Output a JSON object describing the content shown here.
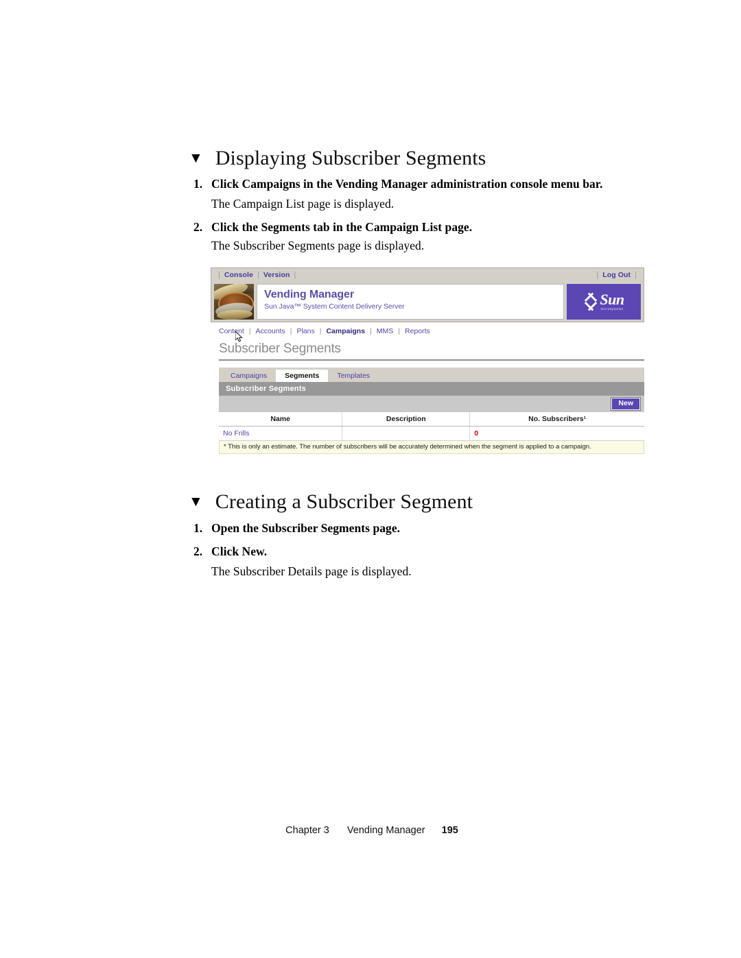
{
  "document": {
    "sections": [
      {
        "heading": "Displaying Subscriber Segments",
        "steps": [
          {
            "num": "1.",
            "text": "Click Campaigns in the Vending Manager administration console menu bar."
          },
          {
            "num": "2.",
            "text": "Click the Segments tab in the Campaign List page."
          }
        ],
        "results": [
          "The Campaign List page is displayed.",
          "The Subscriber Segments page is displayed."
        ]
      },
      {
        "heading": "Creating a Subscriber Segment",
        "steps": [
          {
            "num": "1.",
            "text": "Open the Subscriber Segments page."
          },
          {
            "num": "2.",
            "text": "Click New."
          }
        ],
        "results": [
          "The Subscriber Details page is displayed."
        ]
      }
    ],
    "footer": {
      "chapter": "Chapter 3",
      "title": "Vending Manager",
      "page": "195"
    },
    "marker_glyph": "▼"
  },
  "screenshot": {
    "topbar": {
      "left_links": [
        "Console",
        "Version"
      ],
      "right_links": [
        "Log Out"
      ],
      "separator": "|"
    },
    "branding": {
      "title": "Vending Manager",
      "subtitle": "Sun Java™ System Content Delivery Server",
      "logo_word": "Sun",
      "logo_tagline": "microsystems",
      "logo_bg": "#5b46b4",
      "thumbnail": "coins-photo"
    },
    "nav": {
      "items": [
        {
          "label": "Content",
          "active": false
        },
        {
          "label": "Accounts",
          "active": false
        },
        {
          "label": "Plans",
          "active": false
        },
        {
          "label": "Campaigns",
          "active": true
        },
        {
          "label": "MMS",
          "active": false
        },
        {
          "label": "Reports",
          "active": false
        }
      ],
      "separator": "|"
    },
    "page_title": "Subscriber Segments",
    "tabs": [
      {
        "label": "Campaigns",
        "active": false
      },
      {
        "label": "Segments",
        "active": true
      },
      {
        "label": "Templates",
        "active": false
      }
    ],
    "panel": {
      "title": "Subscriber Segments",
      "new_button": "New",
      "columns": [
        "Name",
        "Description",
        "No. Subscribers¹"
      ],
      "rows": [
        {
          "name": "No Frills",
          "description": "",
          "subscribers": "0"
        }
      ],
      "footnote": "* This is only an estimate. The number of subscribers will be accurately determined when the segment is applied to a campaign."
    },
    "colors": {
      "link_purple": "#5248a0",
      "brand_purple": "#5a4ea6",
      "button_purple": "#5b46b4",
      "panel_header_gray": "#989898",
      "count_red": "#c00000",
      "footnote_yellow": "#fbfbe4"
    }
  }
}
